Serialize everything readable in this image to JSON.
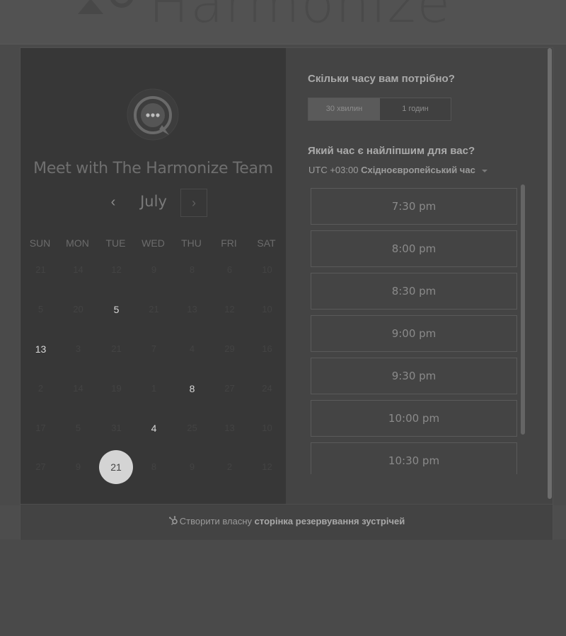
{
  "brand": {
    "logo_text": "Harmonize"
  },
  "calendar": {
    "team_title": "Meet with The Harmonize Team",
    "month": "July",
    "prev_icon": "‹",
    "next_icon": "›",
    "weekdays": [
      "SUN",
      "MON",
      "TUE",
      "WED",
      "THU",
      "FRI",
      "SAT"
    ],
    "days": [
      {
        "label": "21",
        "active": false
      },
      {
        "label": "14",
        "active": false
      },
      {
        "label": "12",
        "active": false
      },
      {
        "label": "9",
        "active": false
      },
      {
        "label": "8",
        "active": false
      },
      {
        "label": "6",
        "active": false
      },
      {
        "label": "10",
        "active": false
      },
      {
        "label": "5",
        "active": false
      },
      {
        "label": "20",
        "active": false
      },
      {
        "label": "5",
        "active": true
      },
      {
        "label": "21",
        "active": false
      },
      {
        "label": "13",
        "active": false
      },
      {
        "label": "12",
        "active": false
      },
      {
        "label": "10",
        "active": false
      },
      {
        "label": "13",
        "active": true
      },
      {
        "label": "3",
        "active": false
      },
      {
        "label": "21",
        "active": false
      },
      {
        "label": "7",
        "active": false
      },
      {
        "label": "4",
        "active": false
      },
      {
        "label": "29",
        "active": false
      },
      {
        "label": "16",
        "active": false
      },
      {
        "label": "2",
        "active": false
      },
      {
        "label": "14",
        "active": false
      },
      {
        "label": "19",
        "active": false
      },
      {
        "label": "1",
        "active": false
      },
      {
        "label": "8",
        "active": true
      },
      {
        "label": "27",
        "active": false
      },
      {
        "label": "24",
        "active": false
      },
      {
        "label": "17",
        "active": false
      },
      {
        "label": "5",
        "active": false
      },
      {
        "label": "31",
        "active": false
      },
      {
        "label": "4",
        "active": true
      },
      {
        "label": "25",
        "active": false
      },
      {
        "label": "13",
        "active": false
      },
      {
        "label": "10",
        "active": false
      },
      {
        "label": "27",
        "active": false
      },
      {
        "label": "9",
        "active": false
      },
      {
        "label": "21",
        "active": true,
        "selected": true
      },
      {
        "label": "8",
        "active": false
      },
      {
        "label": "9",
        "active": false
      },
      {
        "label": "2",
        "active": false
      },
      {
        "label": "12",
        "active": false
      }
    ]
  },
  "scheduler": {
    "duration_question": "Скільки часу вам потрібно?",
    "durations": [
      {
        "label": "30 хвилин",
        "selected": true
      },
      {
        "label": "1 годин",
        "selected": false
      }
    ],
    "time_question": "Який час є найліпшим для вас?",
    "timezone_offset": "UTC +03:00",
    "timezone_name": "Східноєвропейський час",
    "slots": [
      "7:30 pm",
      "8:00 pm",
      "8:30 pm",
      "9:00 pm",
      "9:30 pm",
      "10:00 pm",
      "10:30 pm"
    ]
  },
  "footer": {
    "prefix": "Створити власну",
    "link": "сторінка резервування зустрічей"
  }
}
